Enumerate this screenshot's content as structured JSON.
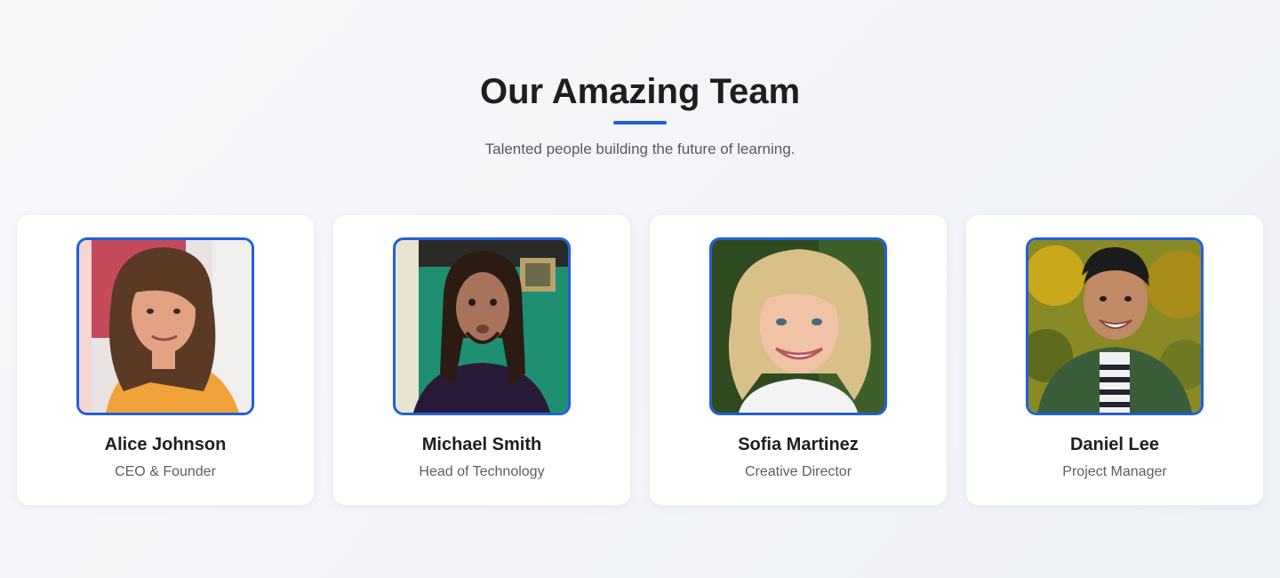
{
  "section": {
    "title": "Our Amazing Team",
    "subtitle": "Talented people building the future of learning."
  },
  "colors": {
    "accent": "#1f5fe0",
    "card_background": "#ffffff",
    "page_background": "#f3f5f8"
  },
  "team": [
    {
      "name": "Alice Johnson",
      "role": "CEO & Founder",
      "photo_icon": "person-photo-icon"
    },
    {
      "name": "Michael Smith",
      "role": "Head of Technology",
      "photo_icon": "person-photo-icon"
    },
    {
      "name": "Sofia Martinez",
      "role": "Creative Director",
      "photo_icon": "person-photo-icon"
    },
    {
      "name": "Daniel Lee",
      "role": "Project Manager",
      "photo_icon": "person-photo-icon"
    }
  ]
}
